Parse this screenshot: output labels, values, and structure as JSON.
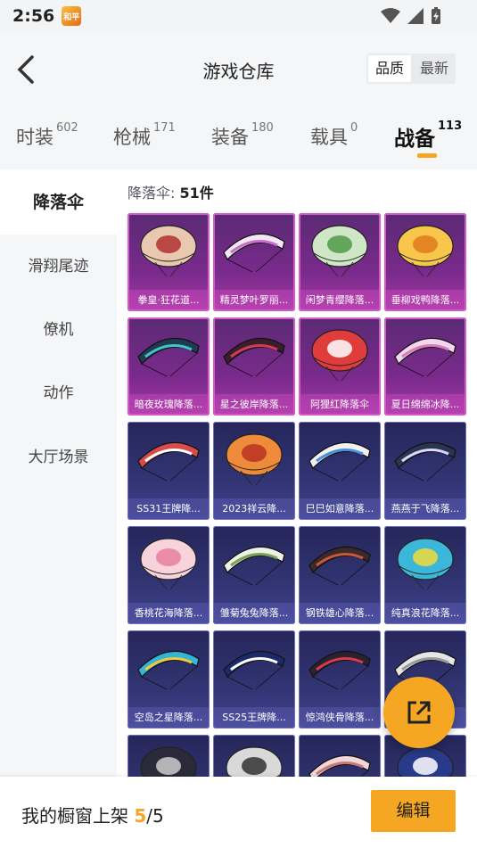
{
  "status_bar": {
    "time": "2:56",
    "app_badge": "和平"
  },
  "header": {
    "title": "游戏仓库",
    "sort_options": [
      "品质",
      "最新"
    ],
    "sort_selected": "品质"
  },
  "tabs": [
    {
      "label": "时装",
      "count": "602"
    },
    {
      "label": "枪械",
      "count": "171"
    },
    {
      "label": "装备",
      "count": "180"
    },
    {
      "label": "载具",
      "count": "0"
    },
    {
      "label": "战备",
      "count": "113"
    }
  ],
  "active_tab": "战备",
  "sidebar": {
    "items": [
      {
        "label": "降落伞"
      },
      {
        "label": "滑翔尾迹"
      },
      {
        "label": "僚机"
      },
      {
        "label": "动作"
      },
      {
        "label": "大厅场景"
      }
    ],
    "active": "降落伞"
  },
  "content": {
    "category_label": "降落伞:",
    "count_text": "51件"
  },
  "items": [
    {
      "name": "拳皇·狂花道...",
      "rarity": "pink",
      "canopy": "#e8c9b0",
      "accent": "#b03030"
    },
    {
      "name": "精灵梦叶罗丽...",
      "rarity": "pink",
      "canopy": "#f2e7f5",
      "accent": "#c770c9"
    },
    {
      "name": "闲梦青缨降落...",
      "rarity": "pink",
      "canopy": "#cfe7c7",
      "accent": "#4f9a4a"
    },
    {
      "name": "垂柳戏鸭降落...",
      "rarity": "pink",
      "canopy": "#f7c64a",
      "accent": "#e07a1b"
    },
    {
      "name": "暗夜玫瑰降落...",
      "rarity": "pink",
      "canopy": "#1f3a52",
      "accent": "#3fc7c7"
    },
    {
      "name": "星之彼岸降落...",
      "rarity": "pink",
      "canopy": "#3a1f2a",
      "accent": "#d03c5a"
    },
    {
      "name": "阿狸红降落伞",
      "rarity": "pink",
      "canopy": "#e03c3c",
      "accent": "#ffffff"
    },
    {
      "name": "夏日绵绵冰降...",
      "rarity": "pink",
      "canopy": "#f4d6ef",
      "accent": "#d97ab9"
    },
    {
      "name": "SS31王牌降...",
      "rarity": "blue",
      "canopy": "#d94a4a",
      "accent": "#ffffff"
    },
    {
      "name": "2023祥云降...",
      "rarity": "blue",
      "canopy": "#ee8b3a",
      "accent": "#b83222"
    },
    {
      "name": "巳巳如意降落...",
      "rarity": "blue",
      "canopy": "#f2f0f5",
      "accent": "#4a8fd9"
    },
    {
      "name": "燕燕于飞降落...",
      "rarity": "blue",
      "canopy": "#2a3550",
      "accent": "#e0d6ff"
    },
    {
      "name": "香桃花海降落...",
      "rarity": "blue",
      "canopy": "#f7d3dc",
      "accent": "#e87ea0"
    },
    {
      "name": "雏菊兔兔降落...",
      "rarity": "blue",
      "canopy": "#eef2e6",
      "accent": "#7aa35a"
    },
    {
      "name": "钢铁雄心降落...",
      "rarity": "blue",
      "canopy": "#3b2a2a",
      "accent": "#c9583a"
    },
    {
      "name": "纯真浪花降落...",
      "rarity": "blue",
      "canopy": "#3ab7d9",
      "accent": "#f2dc3b"
    },
    {
      "name": "空岛之星降落...",
      "rarity": "blue",
      "canopy": "#34b4d6",
      "accent": "#f2c93b"
    },
    {
      "name": "SS25王牌降...",
      "rarity": "blue",
      "canopy": "#1b2a6a",
      "accent": "#ffffff"
    },
    {
      "name": "惊鸿侠骨降落...",
      "rarity": "blue",
      "canopy": "#2a2230",
      "accent": "#d9394a"
    },
    {
      "name": "",
      "rarity": "blue",
      "canopy": "#e6e6e6",
      "accent": "#9a9a9a"
    },
    {
      "name": "",
      "rarity": "blue",
      "canopy": "#2a2a3a",
      "accent": "#cccccc"
    },
    {
      "name": "",
      "rarity": "blue",
      "canopy": "#d9d9d9",
      "accent": "#333333"
    },
    {
      "name": "",
      "rarity": "blue",
      "canopy": "#f2d6d6",
      "accent": "#c77a7a"
    },
    {
      "name": "",
      "rarity": "blue",
      "canopy": "#2a3a8a",
      "accent": "#ffffff"
    }
  ],
  "bottom_bar": {
    "showcase_label": "我的橱窗上架",
    "showcase_current": "5",
    "showcase_total": "/5",
    "edit_label": "编辑"
  }
}
